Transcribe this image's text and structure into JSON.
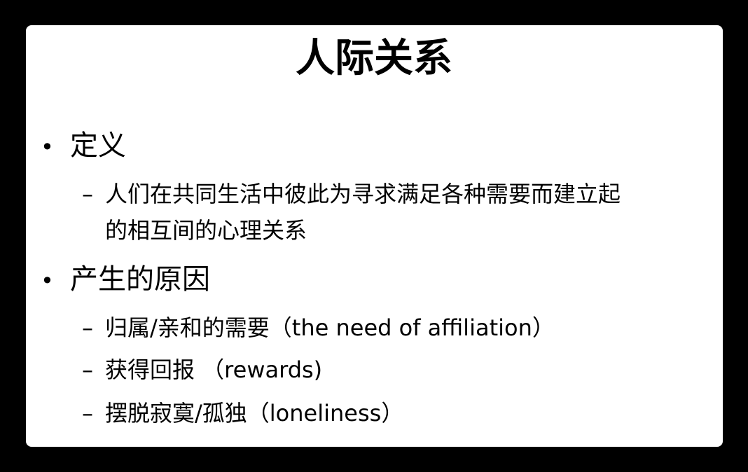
{
  "slide": {
    "title": "人际关系",
    "sections": [
      {
        "bullet": "•",
        "heading": "定义",
        "items": [
          {
            "dash": "–",
            "lines": [
              "人们在共同生活中彼此为寻求满足各种需要而建立起",
              "的相互间的心理关系"
            ]
          }
        ]
      },
      {
        "bullet": "•",
        "heading": "产生的原因",
        "items": [
          {
            "dash": "–",
            "lines": [
              "归属/亲和的需要（the need of affiliation）"
            ]
          },
          {
            "dash": "–",
            "lines": [
              "获得回报 （rewards)"
            ]
          },
          {
            "dash": "–",
            "lines": [
              "摆脱寂寞/孤独（loneliness）"
            ]
          }
        ]
      }
    ]
  },
  "colors": {
    "frame": "#000000",
    "slide_background": "#ffffff",
    "text": "#000000"
  }
}
